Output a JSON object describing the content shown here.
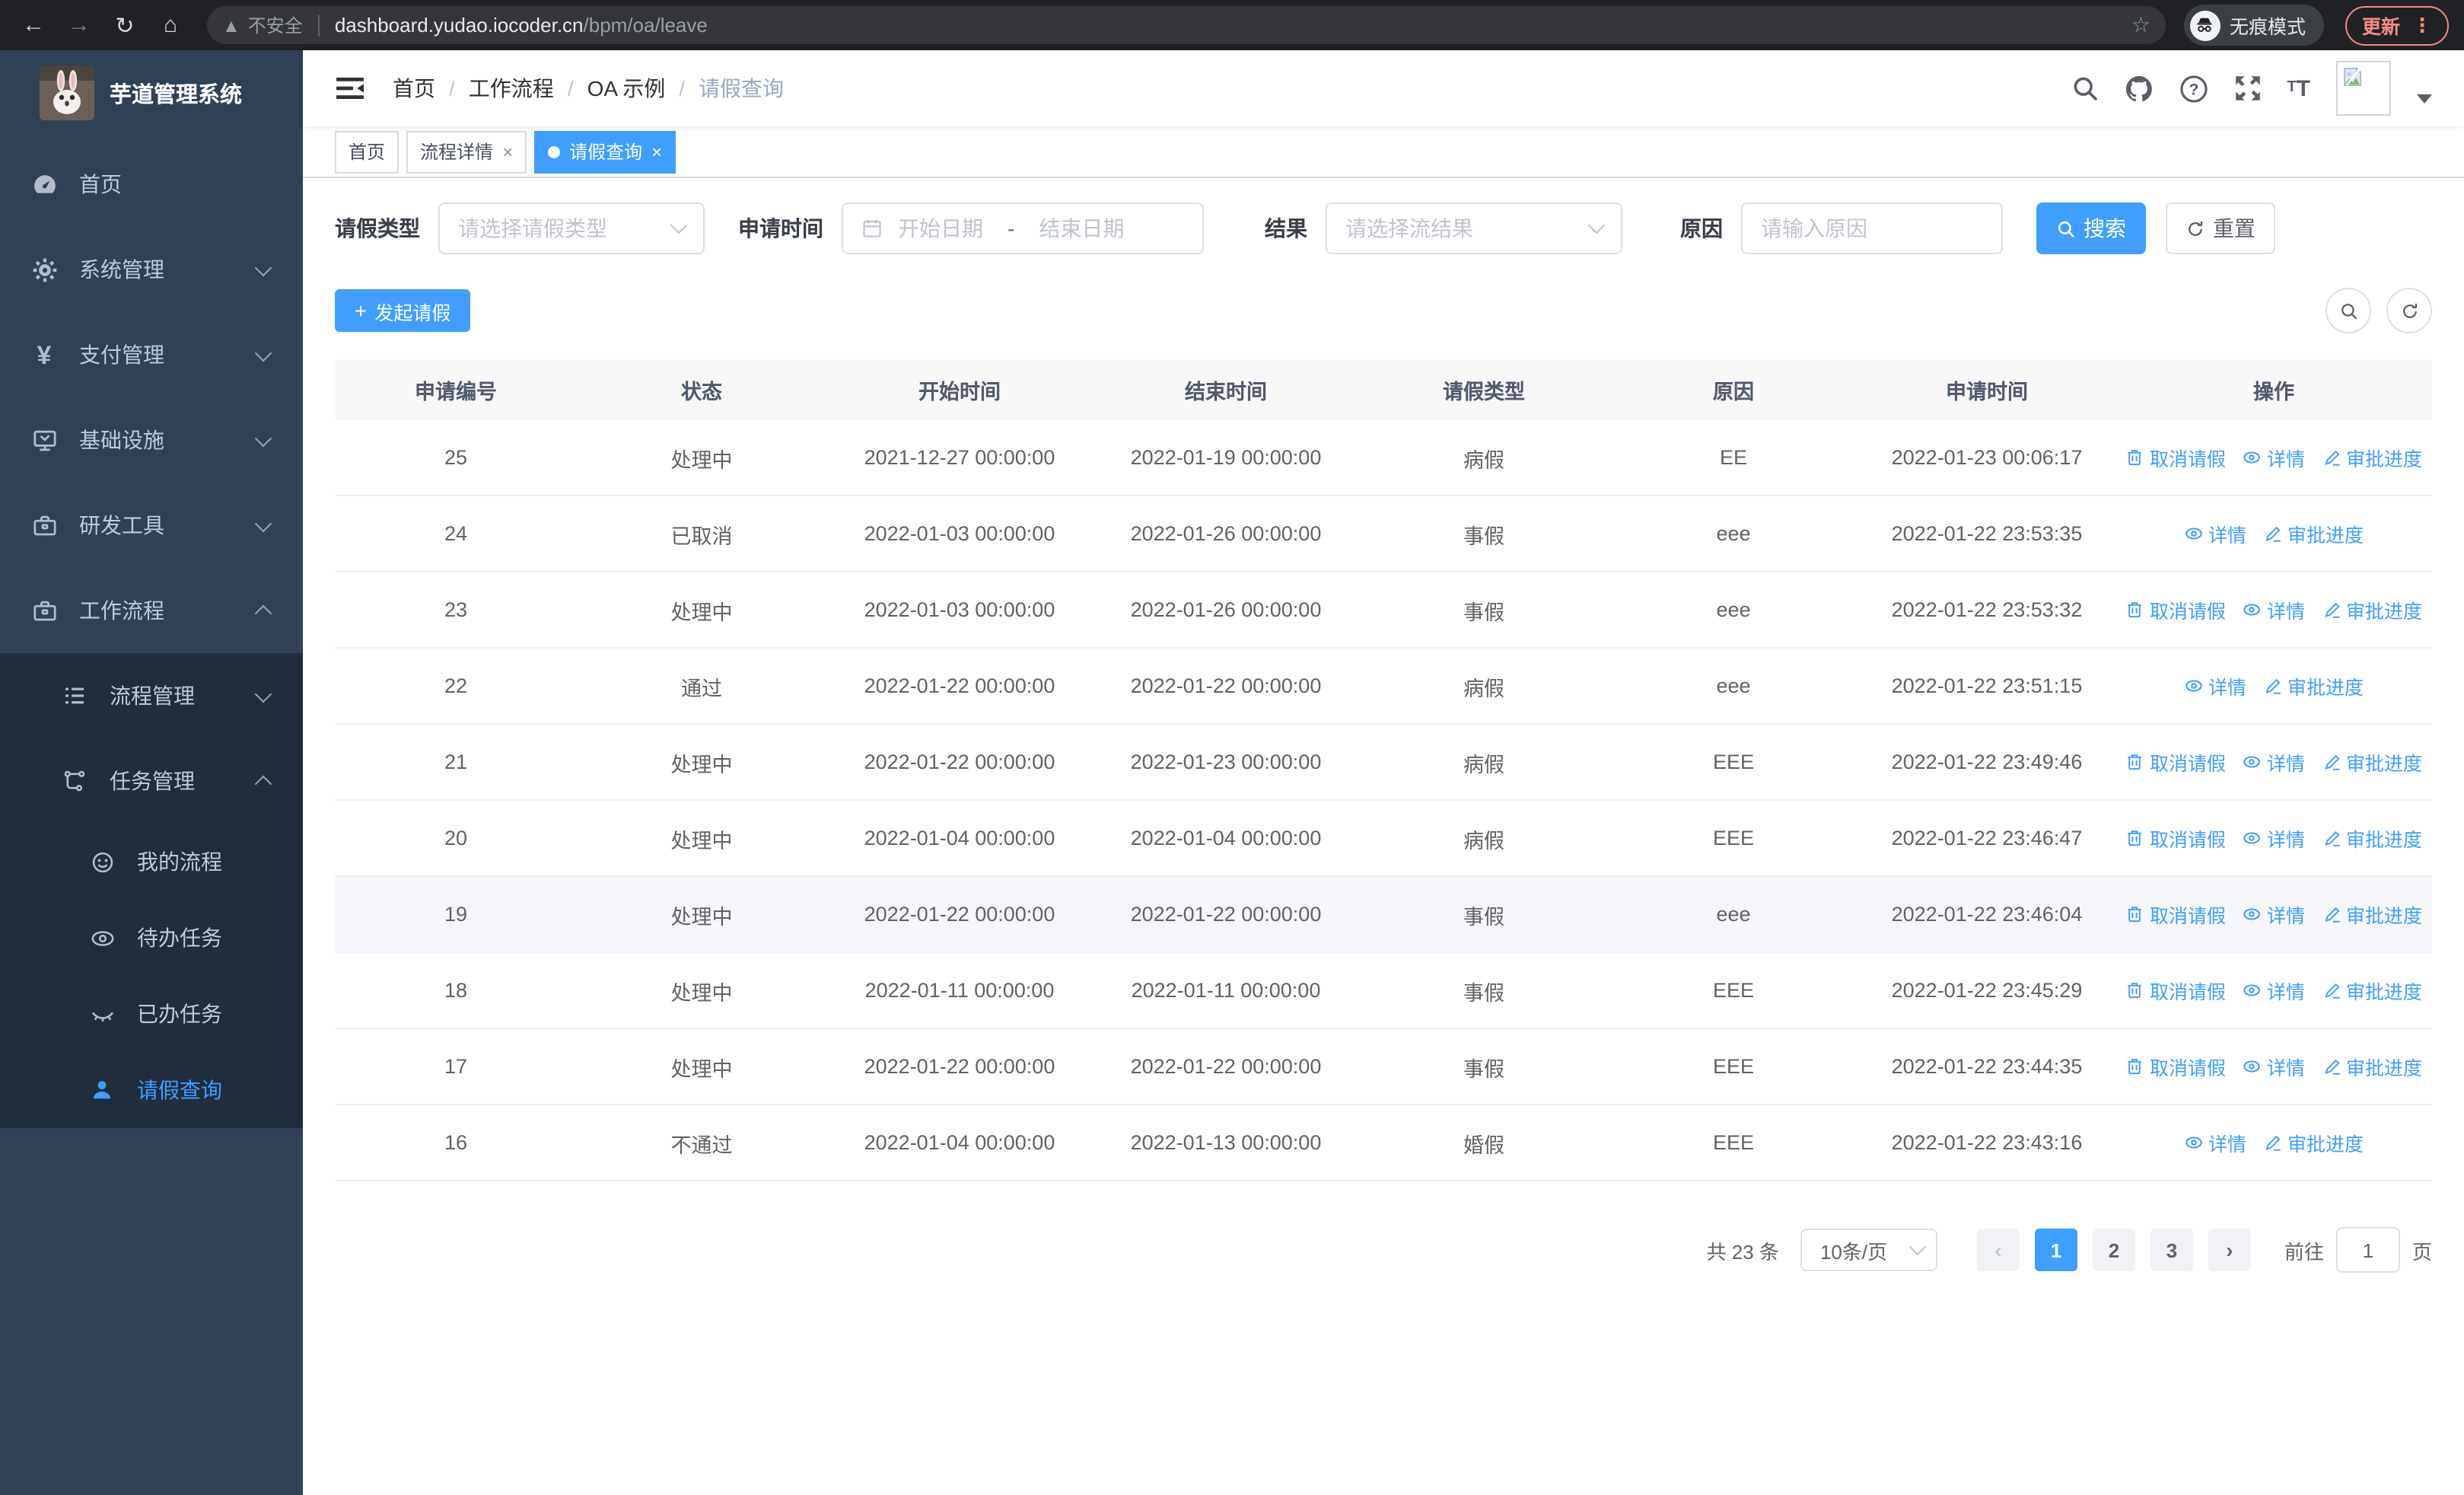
{
  "colors": {
    "accent": "#409eff",
    "sidebar_bg": "#304156",
    "submenu_bg": "#1f2d3d",
    "update_chip": "#f28b82",
    "row_highlight": "#f5f7fa"
  },
  "browser": {
    "security_label": "不安全",
    "url_host": "dashboard.yudao.iocoder.cn",
    "url_path": "/bpm/oa/leave",
    "incognito_label": "无痕模式",
    "update_label": "更新"
  },
  "sidebar": {
    "title": "芋道管理系统",
    "items": [
      {
        "id": "home",
        "icon": "dashboard",
        "label": "首页"
      },
      {
        "id": "system",
        "icon": "gear",
        "label": "系统管理",
        "chevron": "down"
      },
      {
        "id": "pay",
        "icon": "yen",
        "label": "支付管理",
        "chevron": "down"
      },
      {
        "id": "infra",
        "icon": "monitor",
        "label": "基础设施",
        "chevron": "down"
      },
      {
        "id": "devtool",
        "icon": "toolbox",
        "label": "研发工具",
        "chevron": "down"
      },
      {
        "id": "workflow",
        "icon": "briefcase",
        "label": "工作流程",
        "chevron": "up",
        "expanded": true,
        "children": [
          {
            "id": "process-mgmt",
            "icon": "list",
            "label": "流程管理",
            "chevron": "down"
          },
          {
            "id": "task-mgmt",
            "icon": "tree",
            "label": "任务管理",
            "chevron": "up",
            "expanded": true,
            "children": [
              {
                "id": "my-process",
                "icon": "face",
                "label": "我的流程"
              },
              {
                "id": "todo-task",
                "icon": "eye",
                "label": "待办任务"
              },
              {
                "id": "done-task",
                "icon": "eye-closed",
                "label": "已办任务"
              },
              {
                "id": "leave-query",
                "icon": "person",
                "label": "请假查询",
                "active": true
              }
            ]
          }
        ]
      }
    ]
  },
  "breadcrumb": [
    "首页",
    "工作流程",
    "OA 示例",
    "请假查询"
  ],
  "tabs": [
    {
      "label": "首页"
    },
    {
      "label": "流程详情",
      "closable": true
    },
    {
      "label": "请假查询",
      "closable": true,
      "active": true,
      "dot": true
    }
  ],
  "filters": {
    "type_label": "请假类型",
    "type_placeholder": "请选择请假类型",
    "time_label": "申请时间",
    "start_placeholder": "开始日期",
    "date_separator": "-",
    "end_placeholder": "结束日期",
    "result_label": "结果",
    "result_placeholder": "请选择流结果",
    "reason_label": "原因",
    "reason_placeholder": "请输入原因",
    "search_label": "搜索",
    "reset_label": "重置"
  },
  "toolbar": {
    "create_label": "发起请假"
  },
  "table": {
    "headers": [
      "申请编号",
      "状态",
      "开始时间",
      "结束时间",
      "请假类型",
      "原因",
      "申请时间",
      "操作"
    ],
    "action_labels": {
      "cancel": "取消请假",
      "detail": "详情",
      "progress": "审批进度"
    },
    "highlighted_row_id": "19",
    "rows": [
      {
        "id": "25",
        "status": "处理中",
        "start": "2021-12-27 00:00:00",
        "end": "2022-01-19 00:00:00",
        "type": "病假",
        "reason": "EE",
        "apply": "2022-01-23 00:06:17",
        "actions": [
          "cancel",
          "detail",
          "progress"
        ]
      },
      {
        "id": "24",
        "status": "已取消",
        "start": "2022-01-03 00:00:00",
        "end": "2022-01-26 00:00:00",
        "type": "事假",
        "reason": "eee",
        "apply": "2022-01-22 23:53:35",
        "actions": [
          "detail",
          "progress"
        ]
      },
      {
        "id": "23",
        "status": "处理中",
        "start": "2022-01-03 00:00:00",
        "end": "2022-01-26 00:00:00",
        "type": "事假",
        "reason": "eee",
        "apply": "2022-01-22 23:53:32",
        "actions": [
          "cancel",
          "detail",
          "progress"
        ]
      },
      {
        "id": "22",
        "status": "通过",
        "start": "2022-01-22 00:00:00",
        "end": "2022-01-22 00:00:00",
        "type": "病假",
        "reason": "eee",
        "apply": "2022-01-22 23:51:15",
        "actions": [
          "detail",
          "progress"
        ]
      },
      {
        "id": "21",
        "status": "处理中",
        "start": "2022-01-22 00:00:00",
        "end": "2022-01-23 00:00:00",
        "type": "病假",
        "reason": "EEE",
        "apply": "2022-01-22 23:49:46",
        "actions": [
          "cancel",
          "detail",
          "progress"
        ]
      },
      {
        "id": "20",
        "status": "处理中",
        "start": "2022-01-04 00:00:00",
        "end": "2022-01-04 00:00:00",
        "type": "病假",
        "reason": "EEE",
        "apply": "2022-01-22 23:46:47",
        "actions": [
          "cancel",
          "detail",
          "progress"
        ]
      },
      {
        "id": "19",
        "status": "处理中",
        "start": "2022-01-22 00:00:00",
        "end": "2022-01-22 00:00:00",
        "type": "事假",
        "reason": "eee",
        "apply": "2022-01-22 23:46:04",
        "actions": [
          "cancel",
          "detail",
          "progress"
        ]
      },
      {
        "id": "18",
        "status": "处理中",
        "start": "2022-01-11 00:00:00",
        "end": "2022-01-11 00:00:00",
        "type": "事假",
        "reason": "EEE",
        "apply": "2022-01-22 23:45:29",
        "actions": [
          "cancel",
          "detail",
          "progress"
        ]
      },
      {
        "id": "17",
        "status": "处理中",
        "start": "2022-01-22 00:00:00",
        "end": "2022-01-22 00:00:00",
        "type": "事假",
        "reason": "EEE",
        "apply": "2022-01-22 23:44:35",
        "actions": [
          "cancel",
          "detail",
          "progress"
        ]
      },
      {
        "id": "16",
        "status": "不通过",
        "start": "2022-01-04 00:00:00",
        "end": "2022-01-13 00:00:00",
        "type": "婚假",
        "reason": "EEE",
        "apply": "2022-01-22 23:43:16",
        "actions": [
          "detail",
          "progress"
        ]
      }
    ]
  },
  "pagination": {
    "total_label": "共 23 条",
    "page_size_label": "10条/页",
    "pages": [
      "1",
      "2",
      "3"
    ],
    "active_page": "1",
    "goto_label": "前往",
    "goto_value": "1",
    "page_unit_label": "页"
  }
}
